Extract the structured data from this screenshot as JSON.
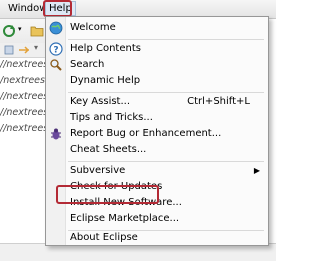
{
  "menubar": {
    "window_label": "Window",
    "help_label": "Help"
  },
  "background": {
    "paths": [
      "//nextreesvn/",
      "/nextreesvn/",
      "//nextreesvn/bc",
      "//nextreesvn/",
      "//nextreesv"
    ]
  },
  "help_menu": {
    "welcome": "Welcome",
    "help_contents": "Help Contents",
    "search": "Search",
    "dynamic_help": "Dynamic Help",
    "key_assist": "Key Assist...",
    "key_assist_shortcut": "Ctrl+Shift+L",
    "tips_and_tricks": "Tips and Tricks...",
    "report_bug": "Report Bug or Enhancement...",
    "cheat_sheets": "Cheat Sheets...",
    "subversive": "Subversive",
    "check_for_updates": "Check for Updates",
    "install_new_software": "Install New Software...",
    "eclipse_marketplace": "Eclipse Marketplace...",
    "about_eclipse": "About Eclipse"
  },
  "colors": {
    "highlight_outline": "#b32a35",
    "menu_bg": "#fbfbfb"
  }
}
